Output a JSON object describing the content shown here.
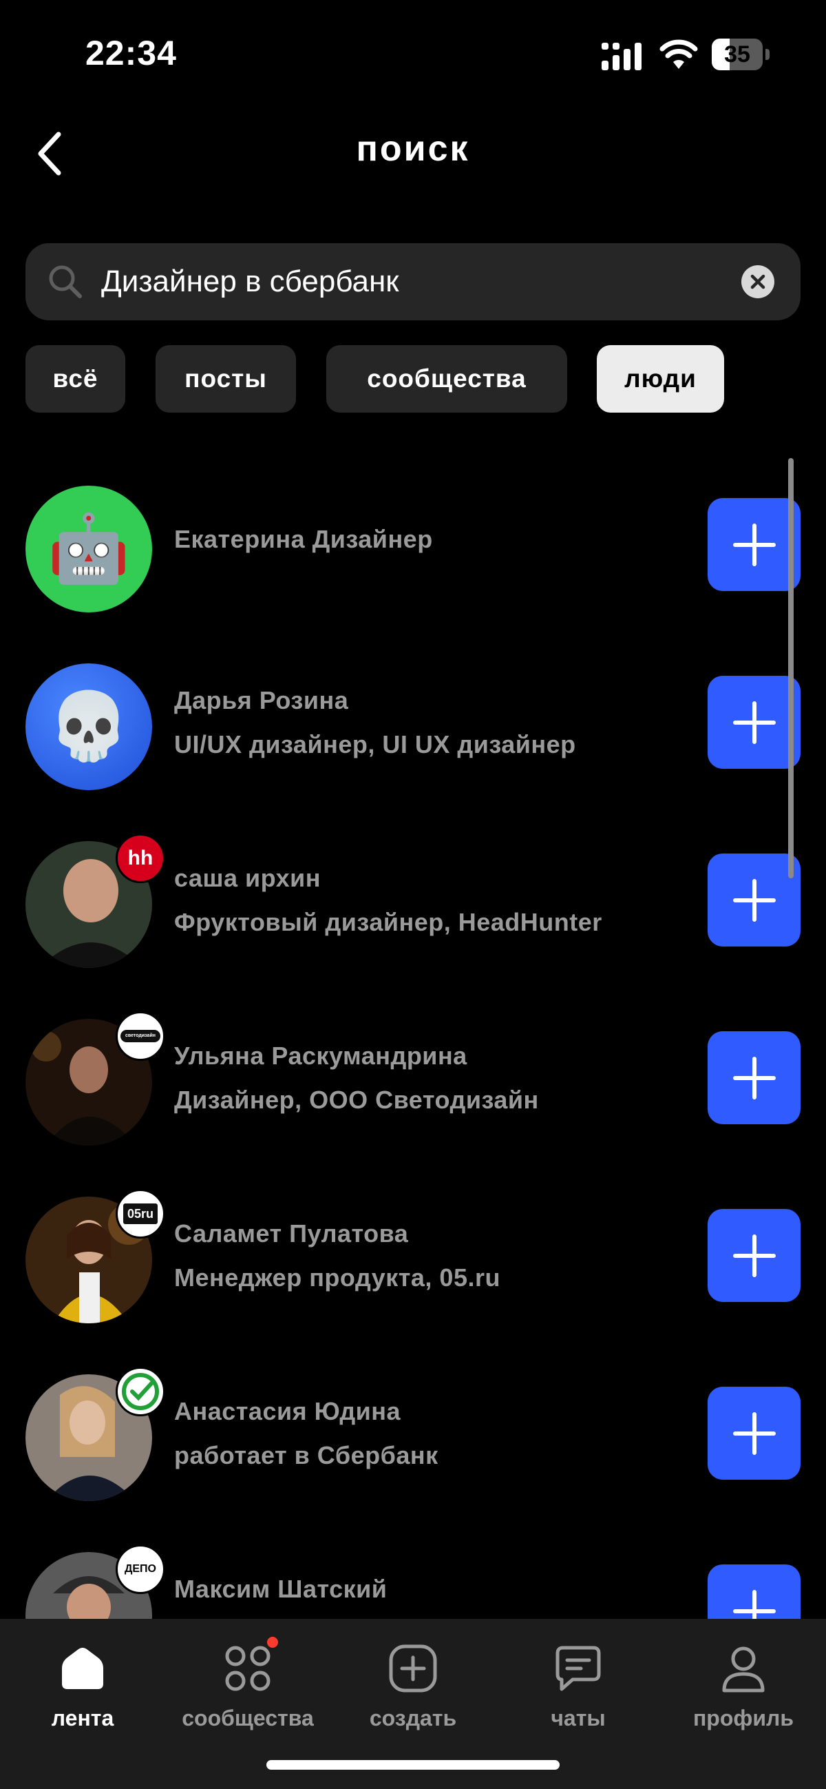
{
  "status_bar": {
    "time": "22:34",
    "battery": "35",
    "battery_level": 0.35,
    "icons": [
      "signal-icon",
      "wifi-icon",
      "battery-icon"
    ]
  },
  "header": {
    "title": "поиск",
    "back_icon": "chevron-left-icon"
  },
  "search": {
    "value": "Дизайнер в сбербанк",
    "icon": "search-icon",
    "clear_icon": "clear-icon"
  },
  "tabs": [
    {
      "label": "всё",
      "active": false
    },
    {
      "label": "посты",
      "active": false
    },
    {
      "label": "сообщества",
      "active": false
    },
    {
      "label": "люди",
      "active": true
    }
  ],
  "people": [
    {
      "name": "Екатерина Дизайнер",
      "subtitle": "",
      "avatar": "robot-emoji-avatar",
      "avatar_glyph": "🤖",
      "avatar_bg": "#33cc55",
      "badge": ""
    },
    {
      "name": "Дарья Розина",
      "subtitle": "UI/UX дизайнер, UI UX дизайнер",
      "avatar": "skull-emoji-avatar",
      "avatar_glyph": "💀",
      "avatar_bg": "#2a66f0",
      "badge": ""
    },
    {
      "name": "саша ирхин",
      "subtitle": "Фруктовый дизайнер, HeadHunter",
      "avatar": "photo-avatar",
      "avatar_glyph": "",
      "avatar_bg": "#3a3a3a",
      "badge": "hh"
    },
    {
      "name": "Ульяна Раскумандрина",
      "subtitle": "Дизайнер, ООО Светодизайн",
      "avatar": "photo-avatar",
      "avatar_glyph": "",
      "avatar_bg": "#2a1a10",
      "badge": "светодизайн"
    },
    {
      "name": "Саламет Пулатова",
      "subtitle": "Менеджер продукта, 05.ru",
      "avatar": "photo-avatar",
      "avatar_glyph": "",
      "avatar_bg": "#4a3018",
      "badge": "05ru"
    },
    {
      "name": "Анастасия Юдина",
      "subtitle": "работает в Сбербанк",
      "avatar": "photo-avatar",
      "avatar_glyph": "",
      "avatar_bg": "#6a6058",
      "badge": "sber"
    },
    {
      "name": "Максим Шатский",
      "subtitle": "",
      "avatar": "photo-avatar",
      "avatar_glyph": "",
      "avatar_bg": "#555555",
      "badge": "ДЕПО"
    }
  ],
  "nav": [
    {
      "label": "лента",
      "icon": "home-icon",
      "active": true
    },
    {
      "label": "сообщества",
      "icon": "grid-icon",
      "active": false,
      "dot": true
    },
    {
      "label": "создать",
      "icon": "plus-square-icon",
      "active": false
    },
    {
      "label": "чаты",
      "icon": "chat-icon",
      "active": false
    },
    {
      "label": "профиль",
      "icon": "profile-icon",
      "active": false
    }
  ],
  "colors": {
    "accent": "#2f5bff",
    "background": "#000000",
    "surface": "#262626",
    "muted_text": "#9a9a9a",
    "notification": "#ff3b30"
  }
}
